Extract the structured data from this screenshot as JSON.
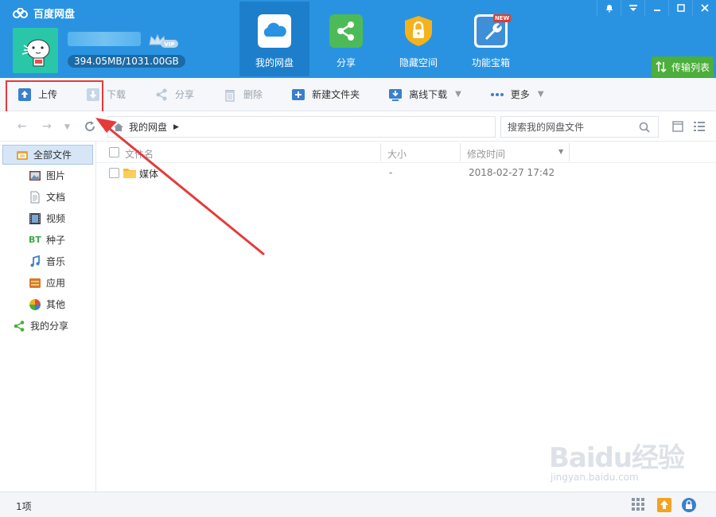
{
  "app": {
    "title": "百度网盘"
  },
  "user": {
    "quota": "394.05MB/1031.00GB",
    "vip": "VIP"
  },
  "nav_tabs": [
    {
      "label": "我的网盘",
      "active": true
    },
    {
      "label": "分享"
    },
    {
      "label": "隐藏空间"
    },
    {
      "label": "功能宝箱",
      "badge": "NEW"
    }
  ],
  "transfer_list": "传输列表",
  "toolbar": {
    "upload": "上传",
    "download": "下载",
    "share": "分享",
    "delete": "删除",
    "new_folder": "新建文件夹",
    "offline_download": "离线下载",
    "more": "更多"
  },
  "breadcrumb": {
    "root": "我的网盘"
  },
  "search": {
    "placeholder": "搜索我的网盘文件"
  },
  "sidebar": {
    "all_files": "全部文件",
    "items": [
      {
        "label": "图片",
        "icon": "image-icon"
      },
      {
        "label": "文档",
        "icon": "document-icon"
      },
      {
        "label": "视频",
        "icon": "video-icon"
      },
      {
        "label": "种子",
        "icon": "bt-icon"
      },
      {
        "label": "音乐",
        "icon": "music-icon"
      },
      {
        "label": "应用",
        "icon": "app-icon"
      },
      {
        "label": "其他",
        "icon": "other-icon"
      }
    ],
    "my_share": "我的分享"
  },
  "file_list": {
    "columns": {
      "name": "文件名",
      "size": "大小",
      "modified": "修改时间"
    },
    "rows": [
      {
        "name": "媒体",
        "size": "-",
        "modified": "2018-02-27 17:42"
      }
    ]
  },
  "status": {
    "count": "1项"
  },
  "watermark": {
    "brand": "Baidu经验",
    "url": "jingyan.baidu.com"
  },
  "colors": {
    "header": "#2a93e1",
    "header_active": "#1d7fcc",
    "accent_red": "#e53a3a",
    "transfer_green": "#4cae3b"
  }
}
